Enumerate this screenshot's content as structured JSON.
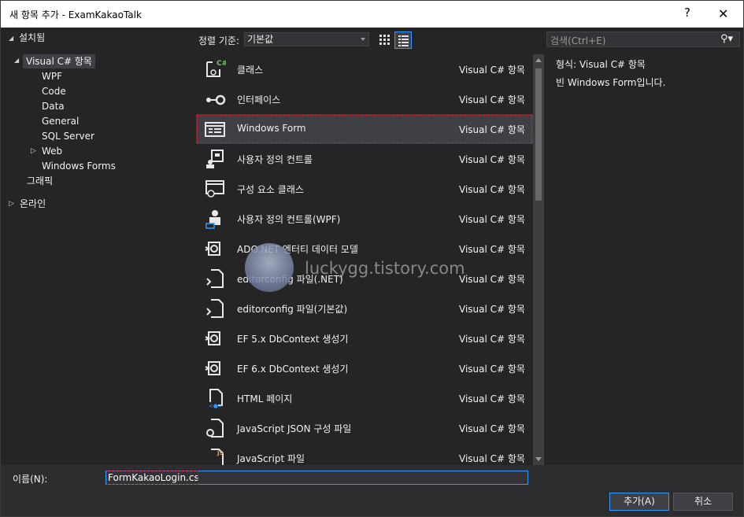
{
  "window": {
    "title": "새 항목 추가 - ExamKakaoTalk",
    "help_label": "?",
    "close_label": "✕"
  },
  "tree": {
    "installed": "설치됨",
    "csharp": "Visual C# 항목",
    "children": [
      "WPF",
      "Code",
      "Data",
      "General",
      "SQL Server",
      "Web",
      "Windows Forms"
    ],
    "graphics": "그래픽",
    "online": "온라인"
  },
  "toolbar": {
    "sort_label": "정렬 기준:",
    "sort_value": "기본값",
    "search_placeholder": "검색(Ctrl+E)"
  },
  "items": [
    {
      "name": "클래스",
      "category": "Visual C# 항목",
      "icon": "class-icon"
    },
    {
      "name": "인터페이스",
      "category": "Visual C# 항목",
      "icon": "interface-icon"
    },
    {
      "name": "Windows Form",
      "category": "Visual C# 항목",
      "icon": "windows-form-icon"
    },
    {
      "name": "사용자 정의 컨트롤",
      "category": "Visual C# 항목",
      "icon": "user-control-icon"
    },
    {
      "name": "구성 요소 클래스",
      "category": "Visual C# 항목",
      "icon": "component-class-icon"
    },
    {
      "name": "사용자 정의 컨트롤(WPF)",
      "category": "Visual C# 항목",
      "icon": "wpf-user-control-icon"
    },
    {
      "name": "ADO.NET 엔터티 데이터 모델",
      "category": "Visual C# 항목",
      "icon": "data-model-icon"
    },
    {
      "name": "editorconfig 파일(.NET)",
      "category": "Visual C# 항목",
      "icon": "editorconfig-icon"
    },
    {
      "name": "editorconfig 파일(기본값)",
      "category": "Visual C# 항목",
      "icon": "editorconfig-icon"
    },
    {
      "name": "EF 5.x DbContext 생성기",
      "category": "Visual C# 항목",
      "icon": "ef-generator-icon"
    },
    {
      "name": "EF 6.x DbContext 생성기",
      "category": "Visual C# 항목",
      "icon": "ef-generator-icon"
    },
    {
      "name": "HTML 페이지",
      "category": "Visual C# 항목",
      "icon": "html-page-icon"
    },
    {
      "name": "JavaScript JSON 구성 파일",
      "category": "Visual C# 항목",
      "icon": "json-config-icon"
    },
    {
      "name": "JavaScript 파일",
      "category": "Visual C# 항목",
      "icon": "javascript-file-icon"
    }
  ],
  "details": {
    "type_label": "형식:",
    "type_value": "Visual C# 항목",
    "description": "빈 Windows Form입니다."
  },
  "watermark": {
    "text": "luckygg.tistory.com"
  },
  "bottom": {
    "name_label": "이름(N):",
    "name_value": "FormKakaoLogin.cs",
    "add_label": "추가(A)",
    "cancel_label": "취소"
  }
}
